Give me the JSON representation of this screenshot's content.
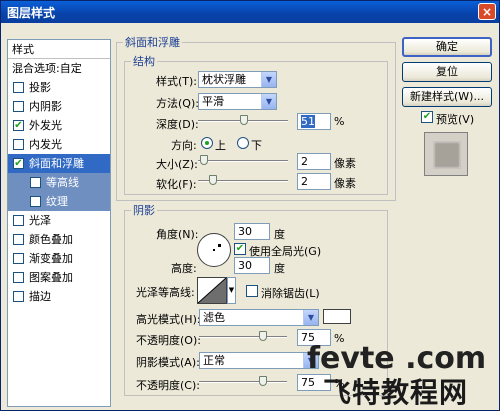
{
  "window": {
    "title": "图层样式",
    "close": "×"
  },
  "style_list": {
    "header": "样式",
    "items": [
      {
        "label": "混合选项:自定",
        "checkbox": false,
        "checked": false,
        "state": "normal"
      },
      {
        "label": "投影",
        "checkbox": true,
        "checked": false,
        "state": "normal"
      },
      {
        "label": "内阴影",
        "checkbox": true,
        "checked": false,
        "state": "normal"
      },
      {
        "label": "外发光",
        "checkbox": true,
        "checked": true,
        "state": "normal"
      },
      {
        "label": "内发光",
        "checkbox": true,
        "checked": false,
        "state": "normal"
      },
      {
        "label": "斜面和浮雕",
        "checkbox": true,
        "checked": true,
        "state": "selected"
      },
      {
        "label": "等高线",
        "checkbox": true,
        "checked": false,
        "state": "sub"
      },
      {
        "label": "纹理",
        "checkbox": true,
        "checked": false,
        "state": "sub"
      },
      {
        "label": "光泽",
        "checkbox": true,
        "checked": false,
        "state": "normal"
      },
      {
        "label": "颜色叠加",
        "checkbox": true,
        "checked": false,
        "state": "normal"
      },
      {
        "label": "渐变叠加",
        "checkbox": true,
        "checked": false,
        "state": "normal"
      },
      {
        "label": "图案叠加",
        "checkbox": true,
        "checked": false,
        "state": "normal"
      },
      {
        "label": "描边",
        "checkbox": true,
        "checked": false,
        "state": "normal"
      }
    ]
  },
  "bevel": {
    "group_title": "斜面和浮雕",
    "structure_title": "结构",
    "style_label": "样式(T):",
    "style_value": "枕状浮雕",
    "technique_label": "方法(Q):",
    "technique_value": "平滑",
    "depth_label": "深度(D):",
    "depth_value": "51",
    "depth_unit": "%",
    "depth_fraction": 0.51,
    "direction_label": "方向:",
    "direction_up": "上",
    "direction_down": "下",
    "direction_selected": "up",
    "size_label": "大小(Z):",
    "size_value": "2",
    "size_unit": "像素",
    "size_fraction": 0.02,
    "soften_label": "软化(F):",
    "soften_value": "2",
    "soften_unit": "像素",
    "soften_fraction": 0.13
  },
  "shading": {
    "title": "阴影",
    "angle_label": "角度(N):",
    "angle_value": "30",
    "angle_unit": "度",
    "global_light_label": "使用全局光(G)",
    "global_light_checked": true,
    "altitude_label": "高度:",
    "altitude_value": "30",
    "altitude_unit": "度",
    "gloss_label": "光泽等高线:",
    "anti_alias_label": "消除锯齿(L)",
    "anti_alias_checked": false,
    "highlight_mode_label": "高光模式(H):",
    "highlight_mode_value": "滤色",
    "highlight_color": "#ffffff",
    "highlight_opacity_label": "不透明度(O):",
    "highlight_opacity_value": "75",
    "highlight_opacity_fraction": 0.75,
    "shadow_mode_label": "阴影模式(A):",
    "shadow_mode_value": "正常",
    "shadow_opacity_label": "不透明度(C):",
    "shadow_opacity_value": "75",
    "shadow_opacity_fraction": 0.75,
    "percent": "%"
  },
  "buttons": {
    "ok": "确定",
    "reset": "复位",
    "new_style": "新建样式(W)...",
    "preview_label": "预览(V)",
    "preview_checked": true
  },
  "watermark": {
    "line1": "fevte .com",
    "line2": "飞特教程网"
  }
}
